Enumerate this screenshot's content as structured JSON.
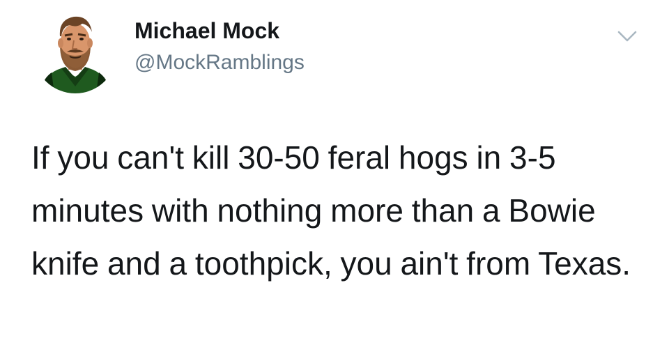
{
  "author": {
    "display_name": "Michael Mock",
    "handle": "@MockRamblings",
    "avatar_icon": "cartoon-bearded-man-avatar"
  },
  "menu": {
    "icon": "chevron-down-icon"
  },
  "tweet": {
    "text": "If you can't kill 30-50 feral hogs in 3-5 minutes with nothing more than a Bowie knife and a toothpick, you ain't from Texas."
  },
  "colors": {
    "text": "#14171a",
    "secondary": "#657786",
    "chevron": "#aab8c2"
  }
}
